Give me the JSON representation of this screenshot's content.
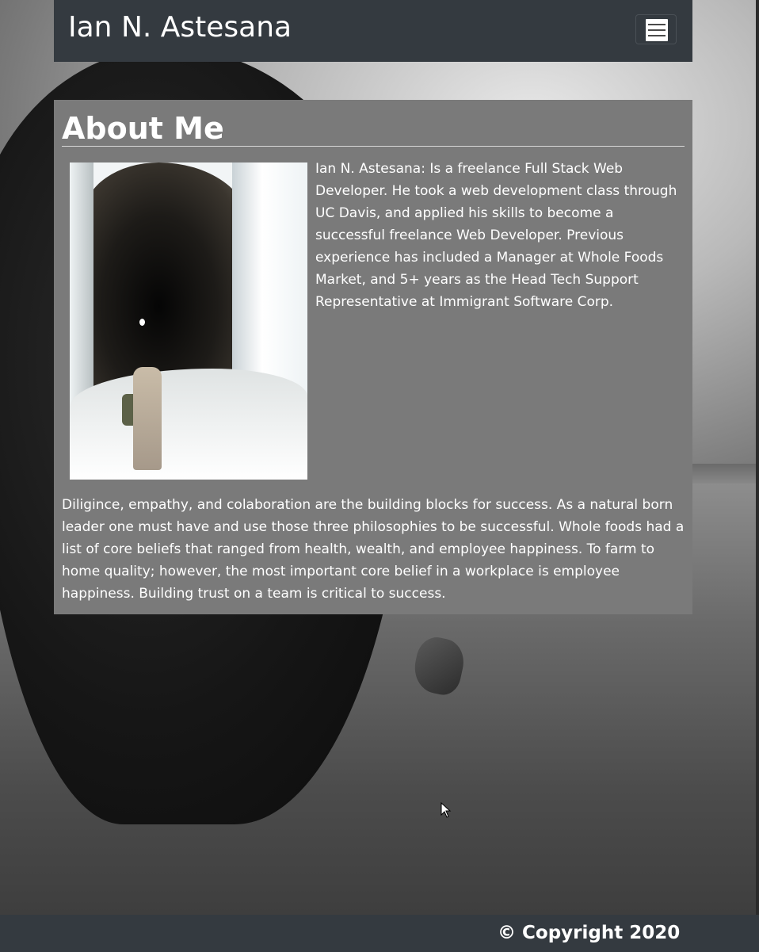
{
  "header": {
    "brand": "Ian N. Astesana",
    "menu_toggle_icon": "hamburger-menu-icon"
  },
  "about": {
    "title": "About Me",
    "photo_alt": "Ian standing in an ice cave",
    "intro": "Ian N. Astesana: Is a freelance Full Stack Web Developer. He took a web development class through UC Davis, and applied his skills to become a successful freelance Web Developer. Previous experience has included a Manager at Whole Foods Market, and 5+ years as the Head Tech Support Representative at Immigrant Software Corp.",
    "philosophy": "Diligince, empathy, and colaboration are the building blocks for success. As a natural born leader one must have and use those three philosophies to be successful. Whole foods had a list of core beliefs that ranged from health, wealth, and employee happiness. To farm to home quality; however, the most important core belief in a workplace is employee happiness. Building trust on a team is critical to success."
  },
  "footer": {
    "copyright": "© Copyright 2020"
  },
  "colors": {
    "navbar": "#343a40",
    "card": "#7a7a7a",
    "text": "#ffffff"
  }
}
